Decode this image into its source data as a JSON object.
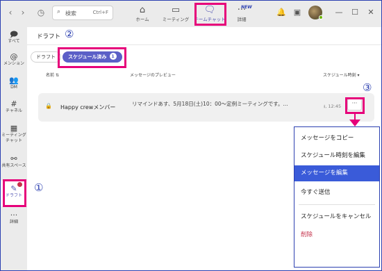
{
  "topbar": {
    "search_placeholder": "検索",
    "search_shortcut": "Ctrl+F",
    "tabs": [
      {
        "label": "ホーム",
        "icon": "home-icon"
      },
      {
        "label": "ミーティング",
        "icon": "video-icon"
      },
      {
        "label": "チームチャット",
        "icon": "chat-icon"
      },
      {
        "label": "詳細",
        "icon": "more-icon"
      }
    ],
    "new_badge": "NEW"
  },
  "rail": {
    "items": [
      {
        "label": "すべて",
        "icon": "chat-bubble-icon"
      },
      {
        "label": "メンション",
        "icon": "at-icon"
      },
      {
        "label": "DM",
        "icon": "people-icon"
      },
      {
        "label": "チャネル",
        "icon": "hash-icon"
      },
      {
        "label": "ミーティング\nチャット",
        "icon": "calendar-icon"
      },
      {
        "label": "共有スペース",
        "icon": "share-icon"
      },
      {
        "label": "ドラフト",
        "icon": "draft-icon"
      },
      {
        "label": "詳細",
        "icon": "more-icon"
      }
    ]
  },
  "main": {
    "title": "ドラフト",
    "filter_all": "ドラフト",
    "filter_scheduled": "スケジュール済み",
    "filter_scheduled_count": "1",
    "col_name": "名前",
    "col_preview": "メッセージのプレビュー",
    "col_schedule": "スケジュール時刻",
    "row": {
      "name": "Happy crewメンバー",
      "preview": "リマインドあす、5月18日(土)10：00～定例ミーティングです。...",
      "time": "12:45"
    }
  },
  "menu": {
    "items": [
      "メッセージをコピー",
      "スケジュール時刻を編集",
      "メッセージを編集",
      "今すぐ送信",
      "スケジュールをキャンセル",
      "削除"
    ]
  },
  "callouts": {
    "one": "①",
    "two": "②",
    "three": "③"
  },
  "colors": {
    "accent": "#5b5fc7",
    "highlight_border": "#e6007a",
    "menu_selected": "#3a5bd9",
    "danger": "#c4314b"
  }
}
